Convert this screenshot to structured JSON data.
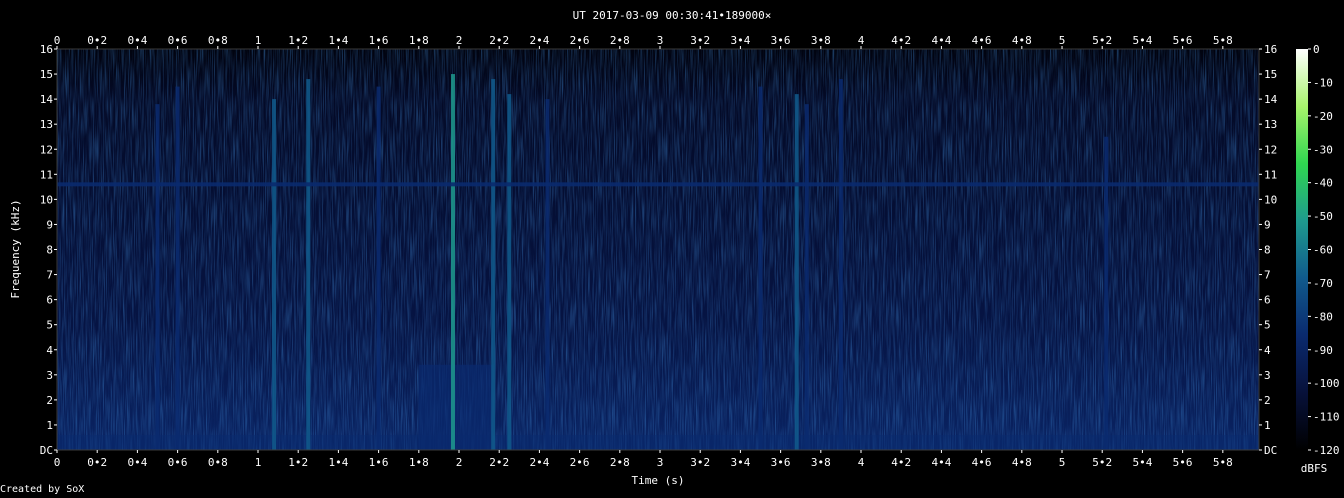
{
  "chart_data": {
    "type": "heatmap",
    "title": "UT 2017-03-09 00:30:41•189000×",
    "xlabel": "Time (s)",
    "ylabel": "Frequency (kHz)",
    "xlim": [
      0,
      5.98
    ],
    "ylim": [
      0,
      16
    ],
    "x_ticks": [
      "0",
      "0•2",
      "0•4",
      "0•6",
      "0•8",
      "1",
      "1•2",
      "1•4",
      "1•6",
      "1•8",
      "2",
      "2•2",
      "2•4",
      "2•6",
      "2•8",
      "3",
      "3•2",
      "3•4",
      "3•6",
      "3•8",
      "4",
      "4•2",
      "4•4",
      "4•6",
      "4•8",
      "5",
      "5•2",
      "5•4",
      "5•6",
      "5•8"
    ],
    "y_ticks": [
      "DC",
      "1",
      "2",
      "3",
      "4",
      "5",
      "6",
      "7",
      "8",
      "9",
      "10",
      "11",
      "12",
      "13",
      "14",
      "15",
      "16"
    ],
    "colorbar": {
      "label": "dBFS",
      "range": [
        -120,
        0
      ],
      "ticks": [
        "0",
        "-10",
        "-20",
        "-30",
        "-40",
        "-50",
        "-60",
        "-70",
        "-80",
        "-90",
        "-100",
        "-110",
        "-120"
      ],
      "colors": [
        "#000000",
        "#07113a",
        "#0a2a6e",
        "#105a8c",
        "#1e9a8e",
        "#2fd650",
        "#a8f46c",
        "#ffffff"
      ]
    },
    "features": {
      "background_dbfs": -100,
      "tone": {
        "freq_khz": 10.6,
        "dbfs": -80
      },
      "low_band": {
        "freq_khz": [
          0,
          0.6
        ],
        "dbfs": -85
      },
      "transients": [
        {
          "t": 0.5,
          "fmax": 13.8,
          "dbfs": -85
        },
        {
          "t": 0.6,
          "fmax": 14.5,
          "dbfs": -82
        },
        {
          "t": 1.08,
          "fmax": 14.0,
          "dbfs": -75
        },
        {
          "t": 1.25,
          "fmax": 14.8,
          "dbfs": -70
        },
        {
          "t": 1.6,
          "fmax": 14.5,
          "dbfs": -84
        },
        {
          "t": 1.97,
          "fmax": 15.0,
          "dbfs": -60
        },
        {
          "t": 2.17,
          "fmax": 14.8,
          "dbfs": -68
        },
        {
          "t": 2.25,
          "fmax": 14.2,
          "dbfs": -75
        },
        {
          "t": 2.44,
          "fmax": 14.0,
          "dbfs": -80
        },
        {
          "t": 3.5,
          "fmax": 14.5,
          "dbfs": -78
        },
        {
          "t": 3.68,
          "fmax": 14.2,
          "dbfs": -76
        },
        {
          "t": 3.73,
          "fmax": 13.8,
          "dbfs": -78
        },
        {
          "t": 3.9,
          "fmax": 14.8,
          "dbfs": -78
        },
        {
          "t": 5.22,
          "fmax": 12.5,
          "dbfs": -86
        }
      ],
      "burst": {
        "t_start": 1.8,
        "t_end": 2.17,
        "fmax_khz": 3.4,
        "dbfs": -82
      }
    }
  },
  "footer": {
    "credit": "Created by SoX"
  }
}
